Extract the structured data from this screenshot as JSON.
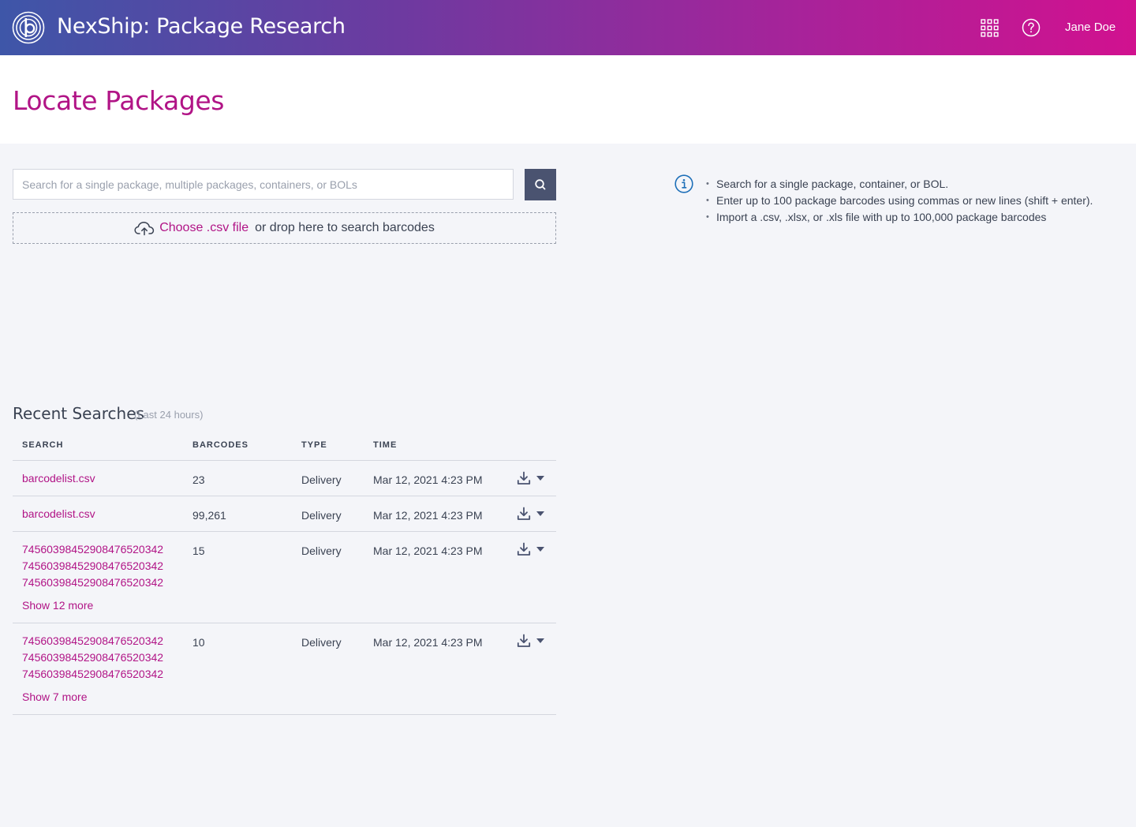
{
  "header": {
    "app_title": "NexShip: Package Research",
    "user_name": "Jane Doe",
    "gradient_start": "#3e56a8",
    "gradient_end": "#d1118f"
  },
  "page": {
    "title": "Locate Packages"
  },
  "search": {
    "placeholder": "Search for a single package, multiple packages, containers, or BOLs",
    "value": ""
  },
  "dropzone": {
    "choose_label": "Choose .csv file",
    "drop_text": "or drop here to search barcodes"
  },
  "info": {
    "bullets": [
      "Search for a single package, container, or BOL.",
      "Enter up to 100 package barcodes using commas or new lines (shift + enter).",
      "Import a .csv, .xlsx, or .xls file with up to 100,000 package barcodes"
    ]
  },
  "recent": {
    "heading": "Recent Searches",
    "subheading": "(Last 24 hours)",
    "columns": [
      "SEARCH",
      "BARCODES",
      "TYPE",
      "TIME"
    ],
    "rows": [
      {
        "search": [
          "barcodelist.csv"
        ],
        "barcodes": "23",
        "type": "Delivery",
        "time": "Mar 12, 2021 4:23 PM",
        "show_more": ""
      },
      {
        "search": [
          "barcodelist.csv"
        ],
        "barcodes": "99,261",
        "type": "Delivery",
        "time": "Mar 12, 2021 4:23 PM",
        "show_more": ""
      },
      {
        "search": [
          "745603984529084765203​42",
          "74560398452908476520342",
          "74560398452908476520342"
        ],
        "barcodes": "15",
        "type": "Delivery",
        "time": "Mar 12, 2021 4:23 PM",
        "show_more": "Show 12 more"
      },
      {
        "search": [
          "74560398452908476520342",
          "74560398452908476520342",
          "74560398452908476520342"
        ],
        "barcodes": "10",
        "type": "Delivery",
        "time": "Mar 12, 2021 4:23 PM",
        "show_more": "Show 7 more"
      }
    ]
  },
  "colors": {
    "accent": "#b11486",
    "button_dark": "#4a5370",
    "info_blue": "#1d6fb8"
  },
  "icons": {
    "logo": "brand-logo-icon",
    "apps": "app-grid-icon",
    "help": "help-circle-icon",
    "search": "search-icon",
    "upload": "cloud-upload-icon",
    "info": "info-icon",
    "download": "download-icon",
    "caret": "caret-down-icon"
  }
}
